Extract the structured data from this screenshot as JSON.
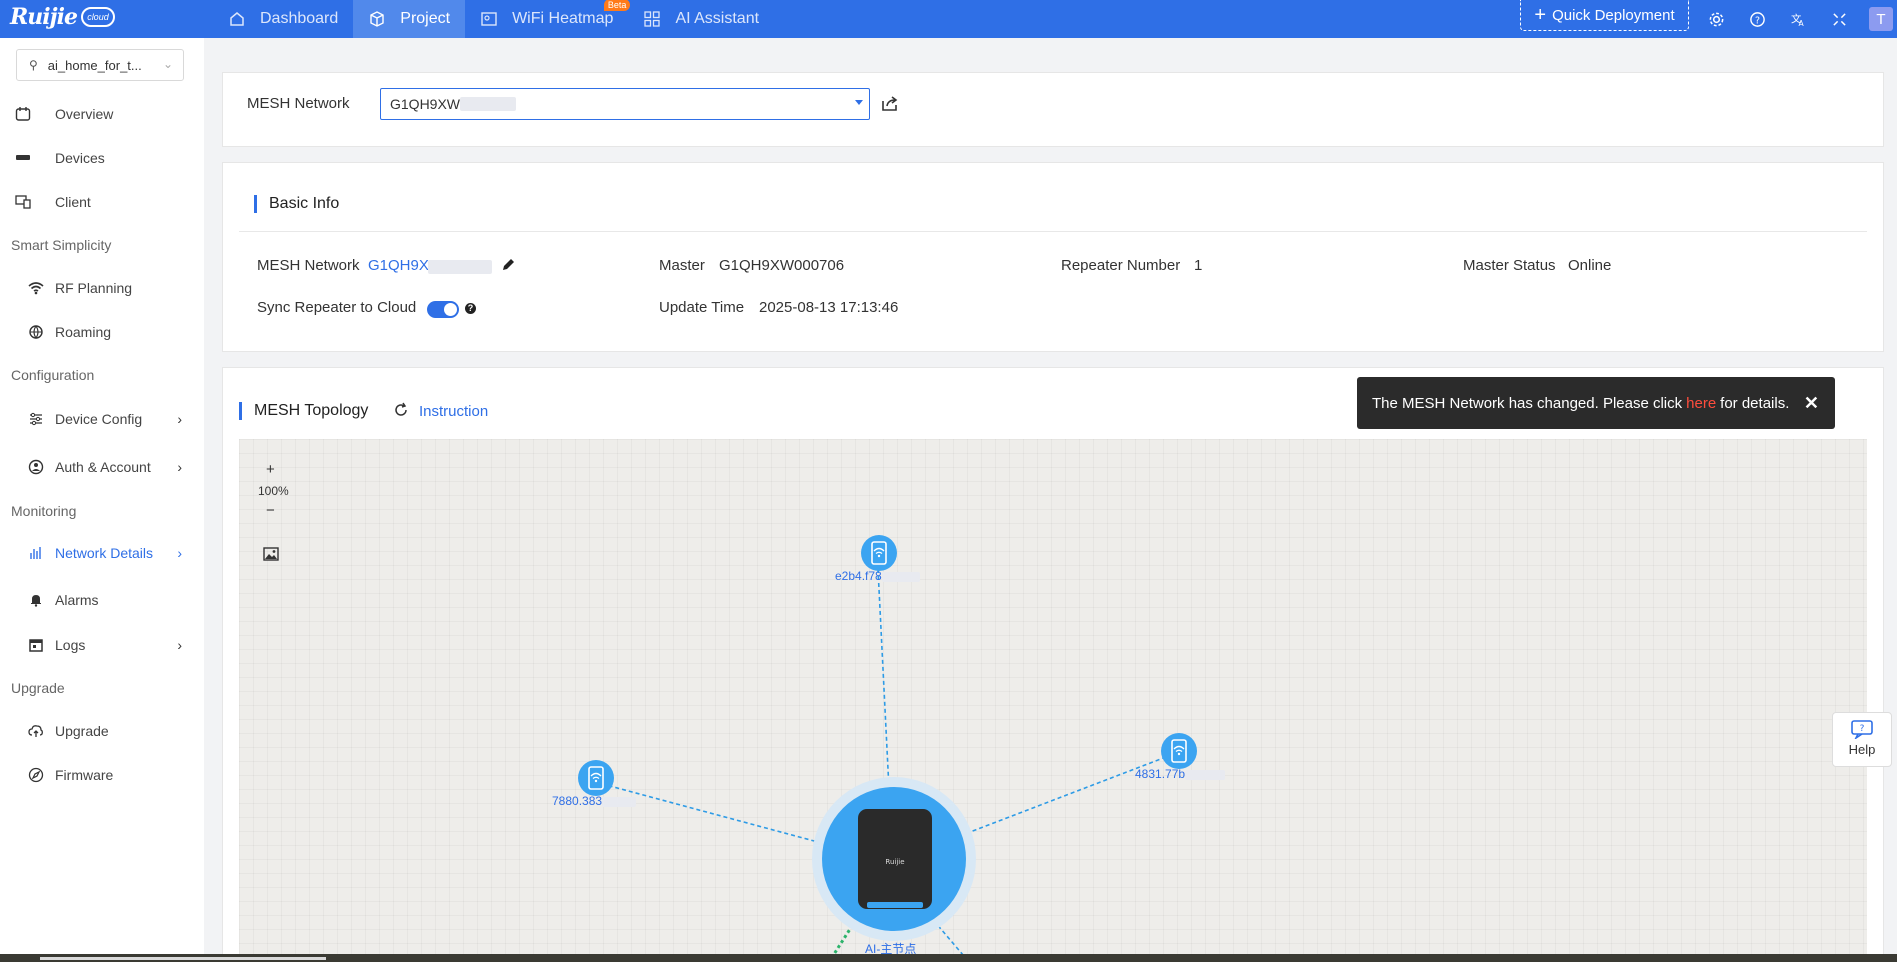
{
  "topbar": {
    "logo_text": "Ruijie",
    "logo_badge": "cloud",
    "nav": [
      {
        "label": "Dashboard",
        "icon": "home-icon"
      },
      {
        "label": "Project",
        "icon": "cube-icon",
        "active": true
      },
      {
        "label": "WiFi Heatmap",
        "icon": "heatmap-icon",
        "badge": "Beta"
      },
      {
        "label": "AI Assistant",
        "icon": "grid-icon"
      }
    ],
    "quick_deployment": "Quick Deployment",
    "avatar_letter": "T",
    "accent_color": "#2f6fe6"
  },
  "sidebar": {
    "project": "ai_home_for_t...",
    "items": {
      "overview": "Overview",
      "devices": "Devices",
      "client": "Client",
      "group_smart": "Smart Simplicity",
      "rf_planning": "RF Planning",
      "roaming": "Roaming",
      "group_config": "Configuration",
      "device_config": "Device Config",
      "auth_account": "Auth & Account",
      "group_monitoring": "Monitoring",
      "network_details": "Network Details",
      "alarms": "Alarms",
      "logs": "Logs",
      "group_upgrade": "Upgrade",
      "upgrade": "Upgrade",
      "firmware": "Firmware"
    }
  },
  "mesh_select": {
    "label": "MESH Network",
    "value": "G1QH9XW"
  },
  "basic_info": {
    "title": "Basic Info",
    "mesh_network_label": "MESH Network",
    "mesh_network_value": "G1QH9X",
    "master_label": "Master",
    "master_value": "G1QH9XW000706",
    "repeater_label": "Repeater Number",
    "repeater_value": "1",
    "status_label": "Master Status",
    "status_value": "Online",
    "sync_label": "Sync Repeater to Cloud",
    "sync_enabled": true,
    "update_label": "Update Time",
    "update_value": "2025-08-13 17:13:46"
  },
  "topology": {
    "title": "MESH Topology",
    "instruction": "Instruction",
    "zoom_plus": "+",
    "zoom_level": "100%",
    "zoom_minus": "−",
    "nodes": {
      "top": "e2b4.f78",
      "left": "7880.383",
      "right": "4831.77b",
      "master": "AI-主节点"
    }
  },
  "toast": {
    "before": "The MESH Network has changed. Please click",
    "link": "here",
    "after": "for details."
  },
  "help": {
    "label": "Help"
  }
}
